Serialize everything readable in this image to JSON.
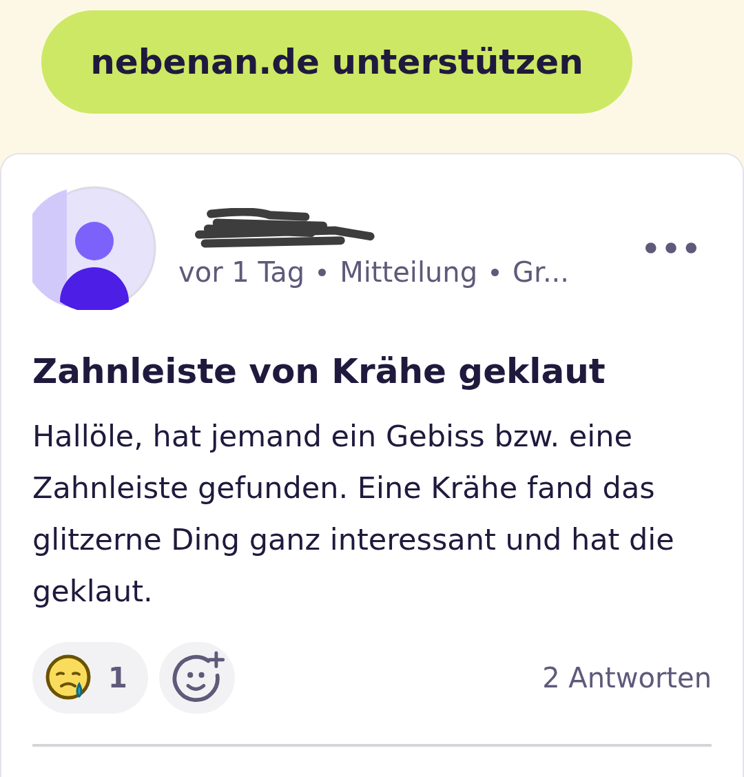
{
  "support_button": {
    "label": "nebenan.de unterstützen"
  },
  "post": {
    "author_redacted": true,
    "meta": [
      "vor 1 Tag",
      "Mitteilung",
      "Gr..."
    ],
    "title": "Zahnleiste von Krähe geklaut",
    "body": "Hallöle, hat jemand ein Gebiss bzw. eine Zahnleiste gefunden. Eine Krähe fand das glitzerne Ding ganz interessant und hat die geklaut.",
    "reactions": [
      {
        "kind": "sad",
        "count": "1"
      }
    ],
    "replies": "2 Antworten"
  }
}
